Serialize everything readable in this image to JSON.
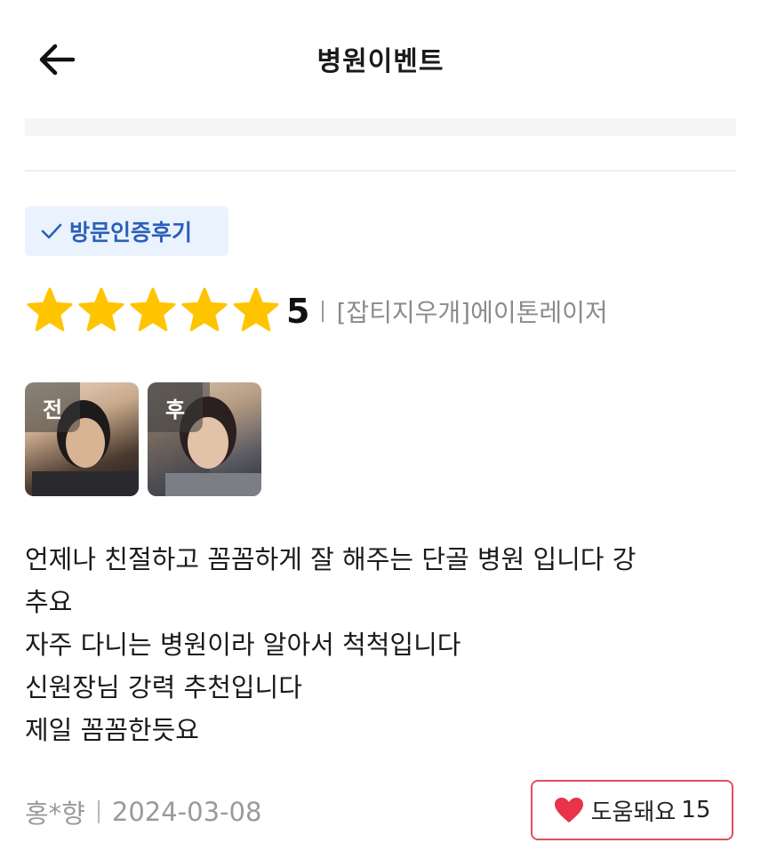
{
  "header": {
    "title": "병원이벤트"
  },
  "badge": {
    "label": "방문인증후기",
    "icon": "check-icon",
    "color": "#2b5fb8",
    "background": "#eaf3fd"
  },
  "rating": {
    "stars": 5,
    "max_stars": 5,
    "score_text": "5",
    "star_color": "#ffc400",
    "product": "[잡티지우개]에이톤레이저"
  },
  "photos": [
    {
      "tag": "전"
    },
    {
      "tag": "후"
    }
  ],
  "review": {
    "lines": [
      "언제나 친절하고 꼼꼼하게 잘 해주는 단골 병원 입니다 강",
      "추요",
      "자주 다니는 병원이라 알아서 척척입니다",
      "신원장님 강력 추천입니다",
      "제일 꼼꼼한듯요"
    ]
  },
  "footer": {
    "author": "홍*향",
    "date": "2024-03-08",
    "helpful_label": "도움돼요",
    "helpful_count": "15",
    "helpful_color": "#e0505e"
  }
}
